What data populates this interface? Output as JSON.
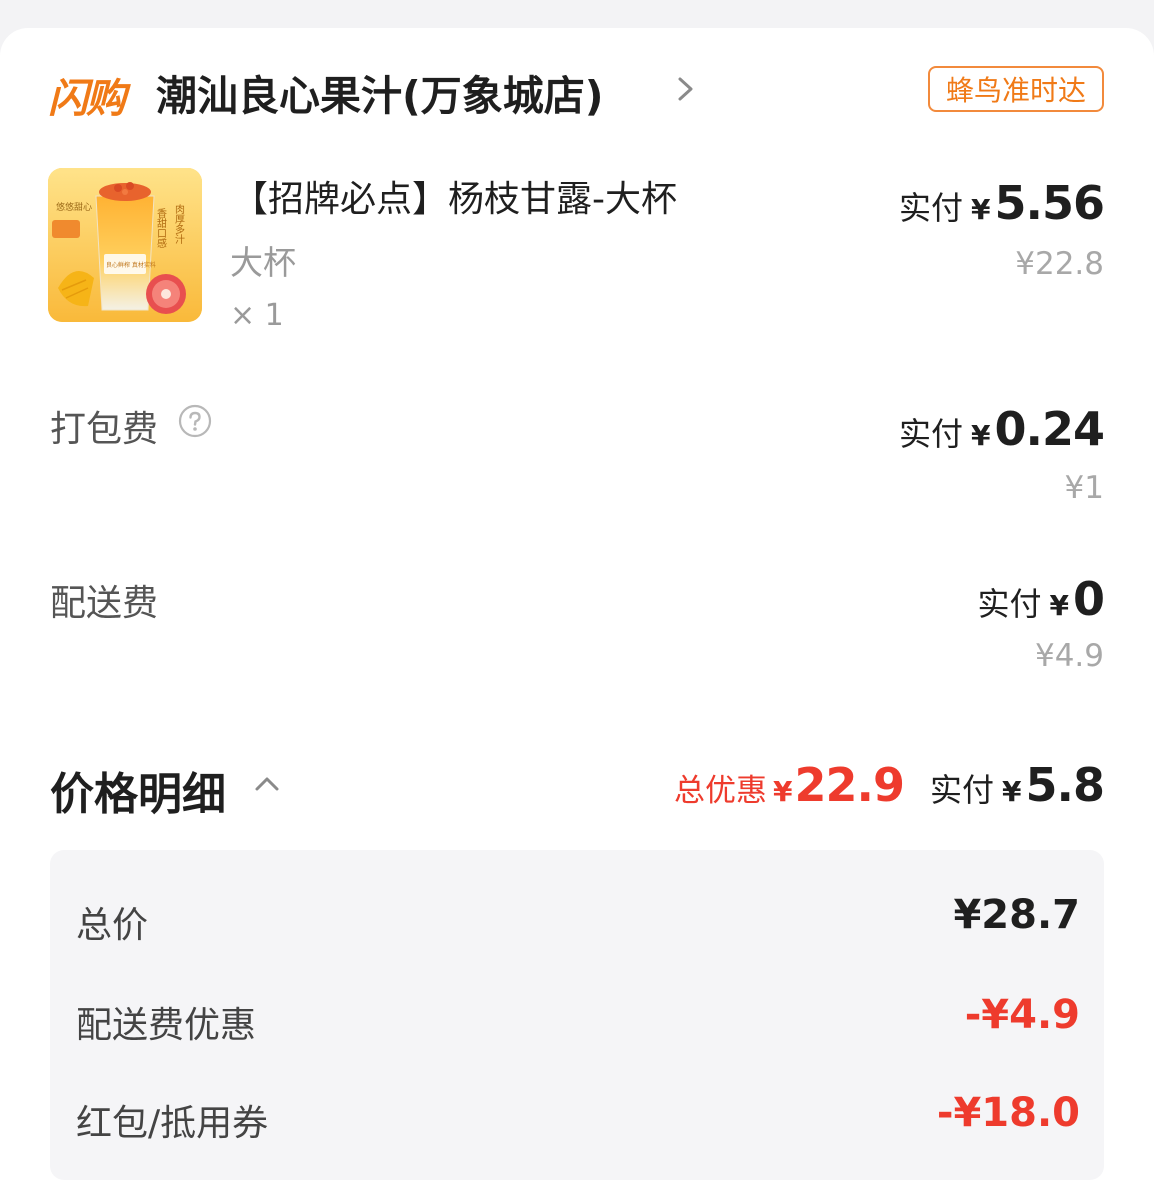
{
  "header": {
    "brand_logo": "闪购",
    "store_name": "潮汕良心果汁(万象城店)",
    "delivery_badge": "蜂鸟准时达"
  },
  "product": {
    "title": "【招牌必点】杨枝甘露-大杯",
    "spec": "大杯",
    "quantity": "× 1",
    "paid_label": "实付",
    "currency": "¥",
    "paid_amount": "5.56",
    "original_price": "¥22.8",
    "image_text": {
      "side_top": "香甜口感",
      "side_right": "肉厚多汁",
      "badge": "悠悠甜心",
      "cup_label": "良心鲜榨 真材实料"
    }
  },
  "packing_fee": {
    "label": "打包费",
    "paid_label": "实付",
    "currency": "¥",
    "paid_amount": "0.24",
    "original_price": "¥1"
  },
  "delivery_fee": {
    "label": "配送费",
    "paid_label": "实付",
    "currency": "¥",
    "paid_amount": "0",
    "original_price": "¥4.9"
  },
  "price_details": {
    "title": "价格明细",
    "total_discount_label": "总优惠",
    "total_discount_currency": "¥",
    "total_discount_amount": "22.9",
    "paid_label": "实付",
    "paid_currency": "¥",
    "paid_amount": "5.8",
    "rows": [
      {
        "label": "总价",
        "value": "¥28.7"
      },
      {
        "label": "配送费优惠",
        "value": "-¥4.9"
      },
      {
        "label": "红包/抵用券",
        "value": "-¥18.0"
      }
    ]
  },
  "colors": {
    "accent_orange": "#f07a17",
    "discount_red": "#ee3b2d",
    "muted_gray": "#a8a8a8"
  },
  "icons": [
    "chevron-right-icon",
    "help-icon",
    "chevron-up-icon"
  ]
}
